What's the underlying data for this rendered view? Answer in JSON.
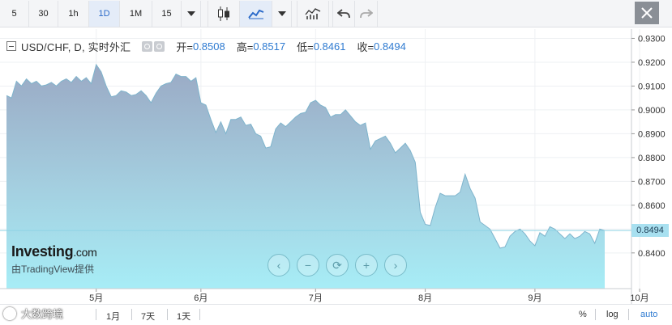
{
  "toolbar": {
    "intervals": [
      "5",
      "30",
      "1h",
      "1D",
      "1M",
      "15"
    ],
    "active_interval": "1D",
    "icons": [
      "interval-dropdown-icon",
      "candlestick-icon",
      "area-chart-icon",
      "chart-type-dropdown-icon",
      "indicators-icon",
      "undo-icon",
      "redo-icon",
      "close-icon"
    ]
  },
  "legend": {
    "symbol": "USD/CHF, D, 实时外汇",
    "open_label": "开=",
    "open": "0.8508",
    "high_label": "高=",
    "high": "0.8517",
    "low_label": "低=",
    "low": "0.8461",
    "close_label": "收=",
    "close": "0.8494"
  },
  "brand": {
    "logo_main": "Investing",
    "logo_suffix": ".com",
    "powered_by": "由TradingView提供"
  },
  "current_price_tag": "0.8494",
  "nav_buttons": [
    "‹",
    "−",
    "⟳",
    "+",
    "›"
  ],
  "bottom_bar": {
    "watermark": "大数跨境",
    "ranges": [
      "1月",
      "7天",
      "1天"
    ],
    "percent": "%",
    "log": "log",
    "auto": "auto"
  },
  "colors": {
    "area_top": "#9aa9c4",
    "area_bottom": "#a7edf6",
    "line": "#7eb4cc",
    "value_blue": "#2f7bd1",
    "price_tag": "#a8e0f0"
  },
  "chart_data": {
    "type": "area",
    "yaxis_ticks": [
      "0.9300",
      "0.9200",
      "0.9100",
      "0.9000",
      "0.8900",
      "0.8800",
      "0.8700",
      "0.8600",
      "0.8500",
      "0.8400"
    ],
    "xaxis_ticks": [
      "5月",
      "6月",
      "7月",
      "8月",
      "9月",
      "10月"
    ],
    "ylim": [
      0.8335,
      0.9305
    ],
    "last_value": 0.8494,
    "grid": true,
    "series": [
      {
        "values": [
          0.906,
          0.905,
          0.912,
          0.91,
          0.913,
          0.911,
          0.912,
          0.91,
          0.9105,
          0.9115,
          0.91,
          0.912,
          0.913,
          0.9115,
          0.914,
          0.912,
          0.9135,
          0.911,
          0.919,
          0.916,
          0.91,
          0.9055,
          0.906,
          0.908,
          0.9075,
          0.906,
          0.9065,
          0.908,
          0.906,
          0.903,
          0.907,
          0.91,
          0.911,
          0.9115,
          0.915,
          0.914,
          0.914,
          0.912,
          0.9135,
          0.903,
          0.902,
          0.896,
          0.8905,
          0.895,
          0.89,
          0.896,
          0.896,
          0.897,
          0.8935,
          0.894,
          0.89,
          0.889,
          0.884,
          0.8845,
          0.892,
          0.8945,
          0.893,
          0.895,
          0.897,
          0.8985,
          0.899,
          0.903,
          0.904,
          0.902,
          0.901,
          0.897,
          0.898,
          0.898,
          0.9,
          0.8975,
          0.895,
          0.8935,
          0.8945,
          0.8835,
          0.887,
          0.888,
          0.889,
          0.886,
          0.882,
          0.884,
          0.886,
          0.883,
          0.878,
          0.857,
          0.852,
          0.8515,
          0.859,
          0.865,
          0.864,
          0.864,
          0.864,
          0.8655,
          0.873,
          0.867,
          0.863,
          0.853,
          0.8515,
          0.85,
          0.846,
          0.842,
          0.8425,
          0.847,
          0.849,
          0.85,
          0.848,
          0.845,
          0.843,
          0.8485,
          0.847,
          0.851,
          0.85,
          0.848,
          0.846,
          0.848,
          0.846,
          0.847,
          0.849,
          0.848,
          0.844,
          0.85,
          0.8494
        ]
      }
    ]
  }
}
